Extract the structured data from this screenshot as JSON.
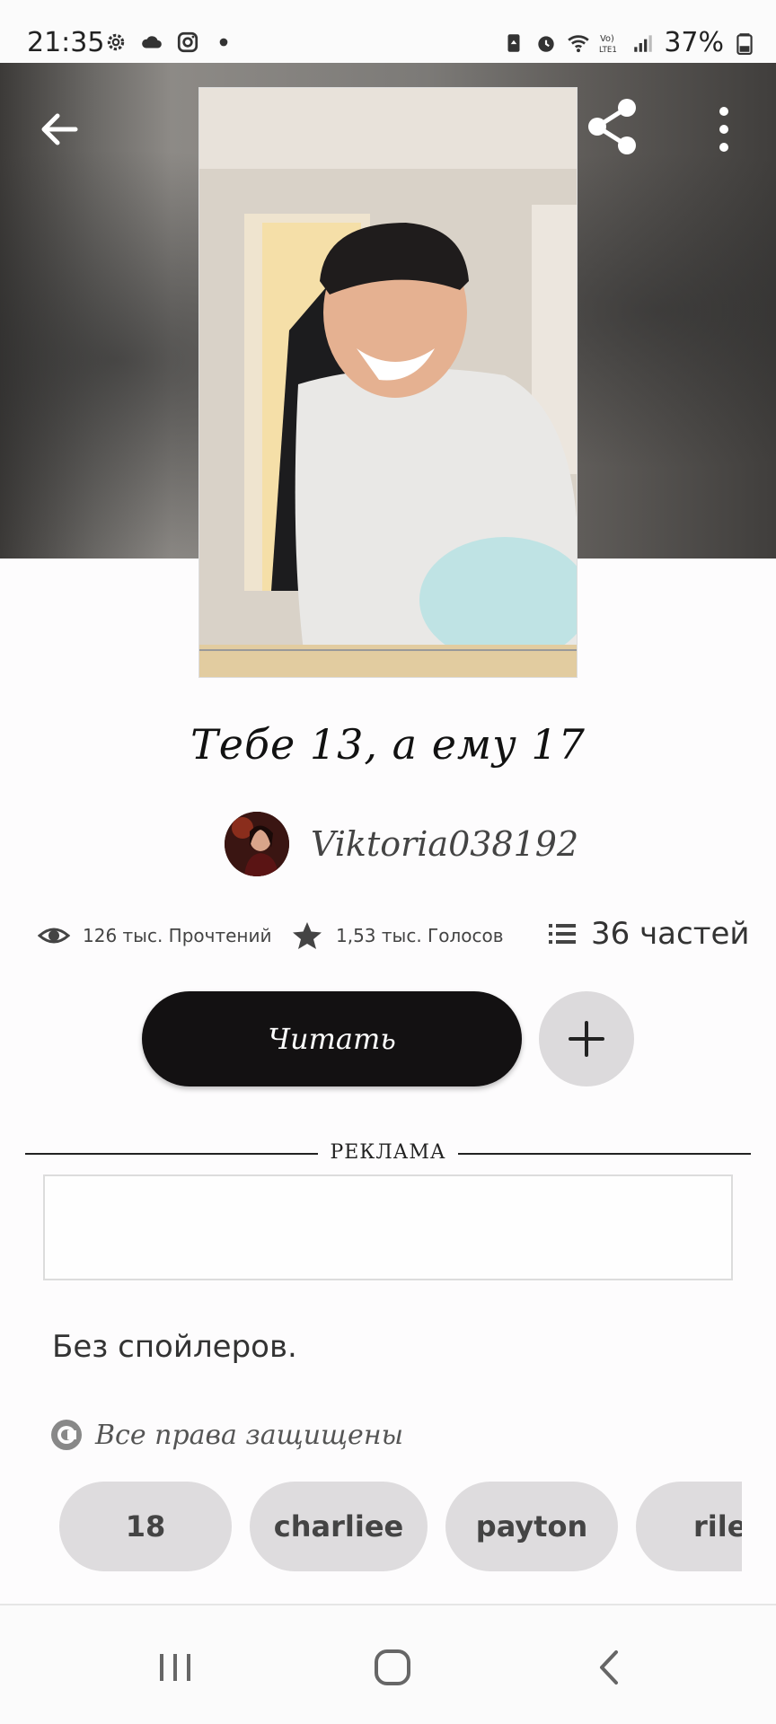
{
  "status_bar": {
    "time": "21:35",
    "battery": "37%",
    "left_icons": [
      "gear-icon",
      "cloud-icon",
      "instagram-icon",
      "dot-icon"
    ],
    "right_icons": [
      "battery-saver-icon",
      "alarm-icon",
      "wifi-icon",
      "volte-icon",
      "signal-icon",
      "battery-icon"
    ]
  },
  "header": {
    "back_icon": "arrow-left-icon",
    "share_icon": "share-icon",
    "more_icon": "more-vertical-icon"
  },
  "story": {
    "title": "Тебе 13, а ему 17",
    "author": "Viktoria038192",
    "reads": "126 тыс. Прочтений",
    "votes": "1,53 тыс. Голосов",
    "parts": "36 частей",
    "read_button": "Читать",
    "ad_label": "РЕКЛАМА",
    "description": "Без спойлеров.",
    "rights": "Все права защищены",
    "tags": [
      "18",
      "charliee",
      "payton",
      "riley"
    ]
  },
  "colors": {
    "read_button_bg": "#131112",
    "tag_bg": "#dedcde",
    "add_button_bg": "#dcdadc"
  }
}
